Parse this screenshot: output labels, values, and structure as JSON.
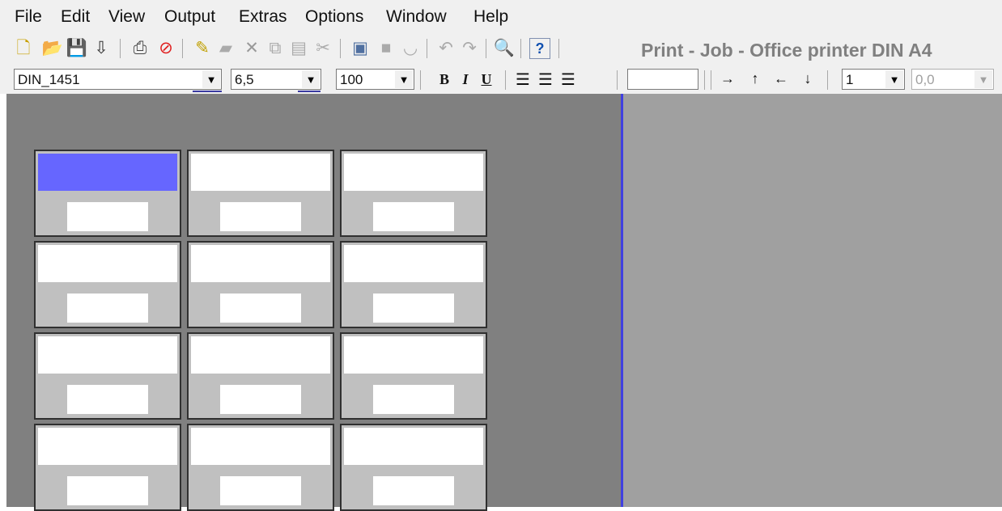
{
  "menu": [
    "File",
    "Edit",
    "View",
    "Output",
    "Extras",
    "Options",
    "Window",
    "Help"
  ],
  "title": "Print - Job - Office printer DIN A4",
  "toolbar_icons": [
    "new-file-icon",
    "open-folder-icon",
    "save-icon",
    "export-icon",
    "print-icon",
    "stop-icon",
    "edit-icon",
    "stamp-icon",
    "delete-icon",
    "copy-icon",
    "paste-icon",
    "cut-icon",
    "insert-image-icon",
    "layer-icon",
    "unlock-icon",
    "undo-icon",
    "redo-icon",
    "zoom-icon",
    "help-icon"
  ],
  "format": {
    "layout_value": "DIN_1451",
    "font_size_value": "6,5",
    "zoom_value": "100",
    "bold": "B",
    "italic": "I",
    "underline": "U",
    "text_field_value": "",
    "count_value": "1",
    "offset_value": "0,0"
  },
  "labels": {
    "rows": 4,
    "cols": 3,
    "selected_index": 0
  },
  "colors": {
    "work_area": "#808080",
    "right_area": "#a0a0a0",
    "label_bg": "#c0c0c0",
    "selected": "#6666ff",
    "border_accent": "#4040e0"
  }
}
